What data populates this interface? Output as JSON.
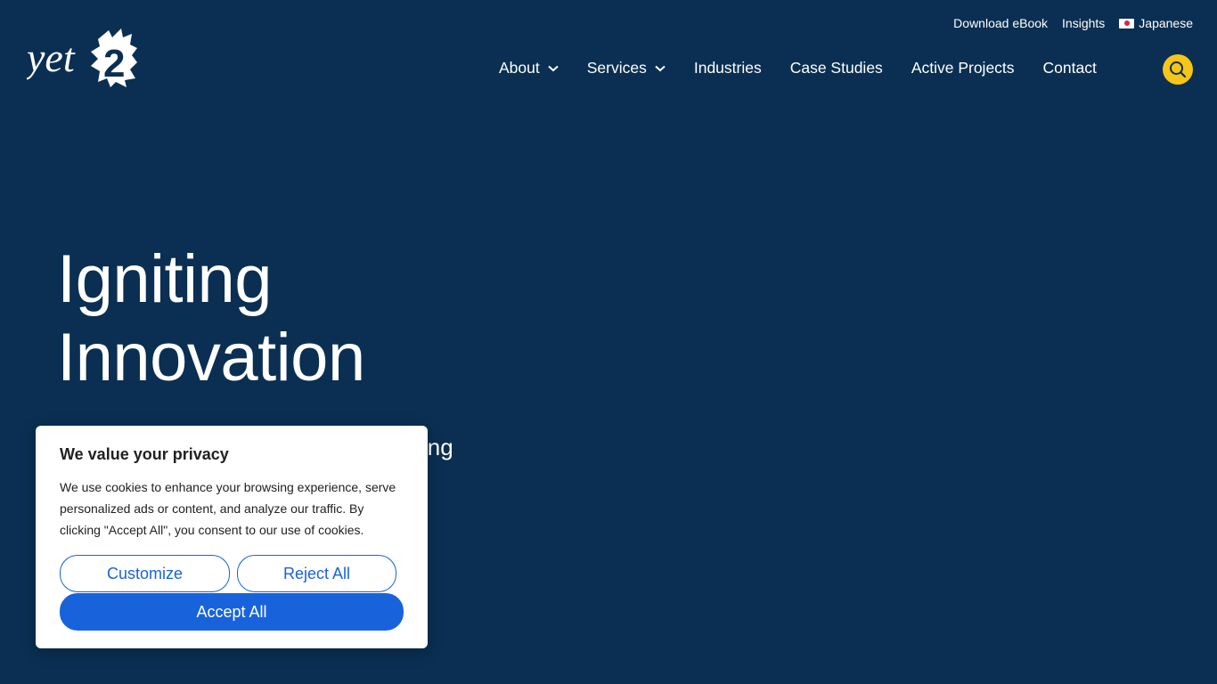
{
  "brand": {
    "logo_text": "yet",
    "logo_digit": "2"
  },
  "utility": {
    "download": "Download eBook",
    "insights": "Insights",
    "language": "Japanese"
  },
  "nav": {
    "items": [
      {
        "label": "About",
        "has_dropdown": true
      },
      {
        "label": "Services",
        "has_dropdown": true
      },
      {
        "label": "Industries",
        "has_dropdown": false
      },
      {
        "label": "Case Studies",
        "has_dropdown": false
      },
      {
        "label": "Active Projects",
        "has_dropdown": false
      },
      {
        "label": "Contact",
        "has_dropdown": false
      }
    ]
  },
  "hero": {
    "title_line1": "Igniting",
    "title_line2": "Innovation",
    "subtitle_visible": "ing"
  },
  "cookie": {
    "title": "We value your privacy",
    "text": "We use cookies to enhance your browsing experience, serve personalized ads or content, and analyze our traffic. By clicking \"Accept All\", you consent to our use of cookies.",
    "customize": "Customize",
    "reject": "Reject All",
    "accept": "Accept All"
  },
  "colors": {
    "background": "#0a2f52",
    "accent_yellow": "#f5c518",
    "button_blue": "#1863dc",
    "text_dark": "#212121"
  },
  "icons": {
    "search": "search-icon",
    "flag": "japan-flag-icon",
    "dropdown": "chevron-down-icon"
  }
}
